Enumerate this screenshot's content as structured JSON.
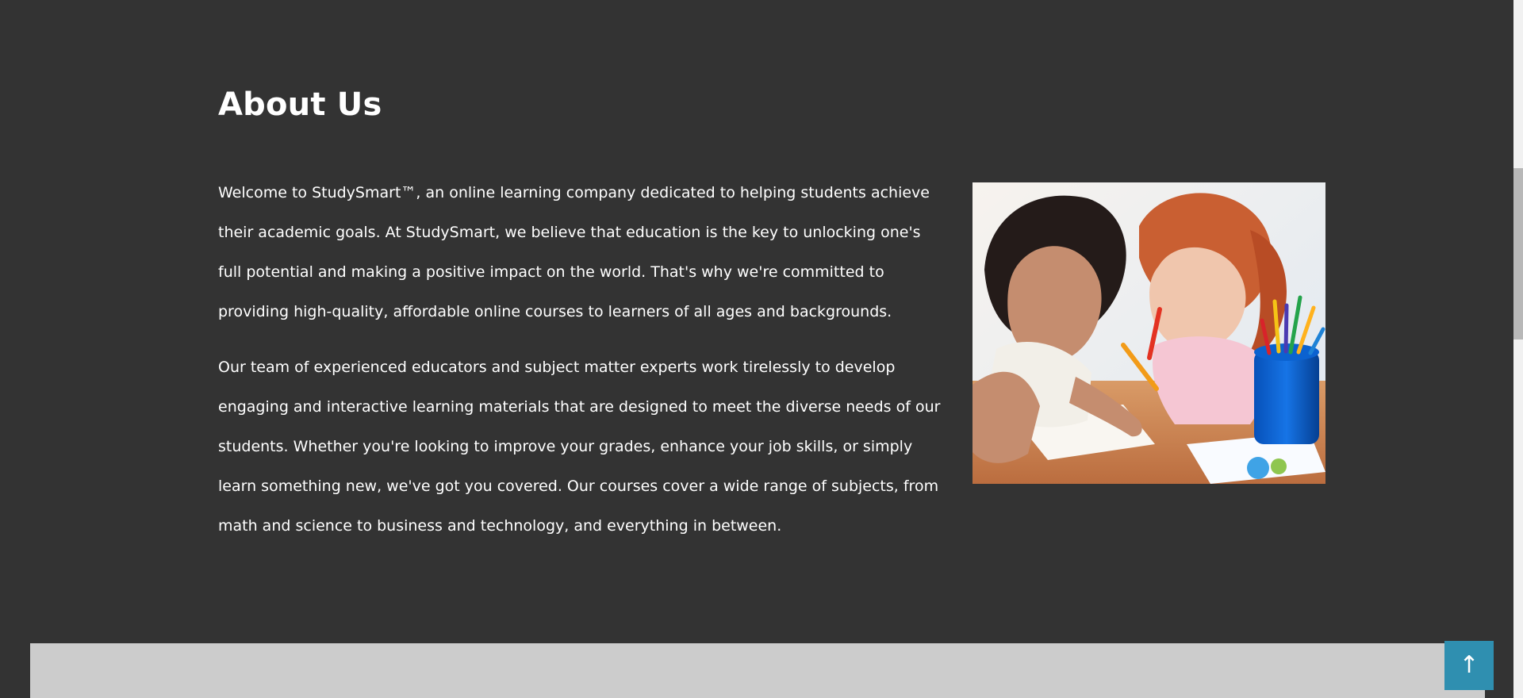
{
  "about": {
    "title": "About Us",
    "paragraphs": [
      "Welcome to StudySmart™, an online learning company dedicated to helping students achieve their academic goals. At StudySmart, we believe that education is the key to unlocking one's full potential and making a positive impact on the world. That's why we're committed to providing high-quality, affordable online courses to learners of all ages and backgrounds.",
      "Our team of experienced educators and subject matter experts work tirelessly to develop engaging and interactive learning materials that are designed to meet the diverse needs of our students. Whether you're looking to improve your grades, enhance your job skills, or simply learn something new, we've got you covered. Our courses cover a wide range of subjects, from math and science to business and technology, and everything in between."
    ]
  },
  "back_to_top": {
    "label": "↑"
  },
  "colors": {
    "background": "#333333",
    "text": "#ffffff",
    "next_section": "#cccccc",
    "back_to_top": "#2f8fb0"
  },
  "icons": {
    "back_to_top": "arrow-up-icon"
  }
}
